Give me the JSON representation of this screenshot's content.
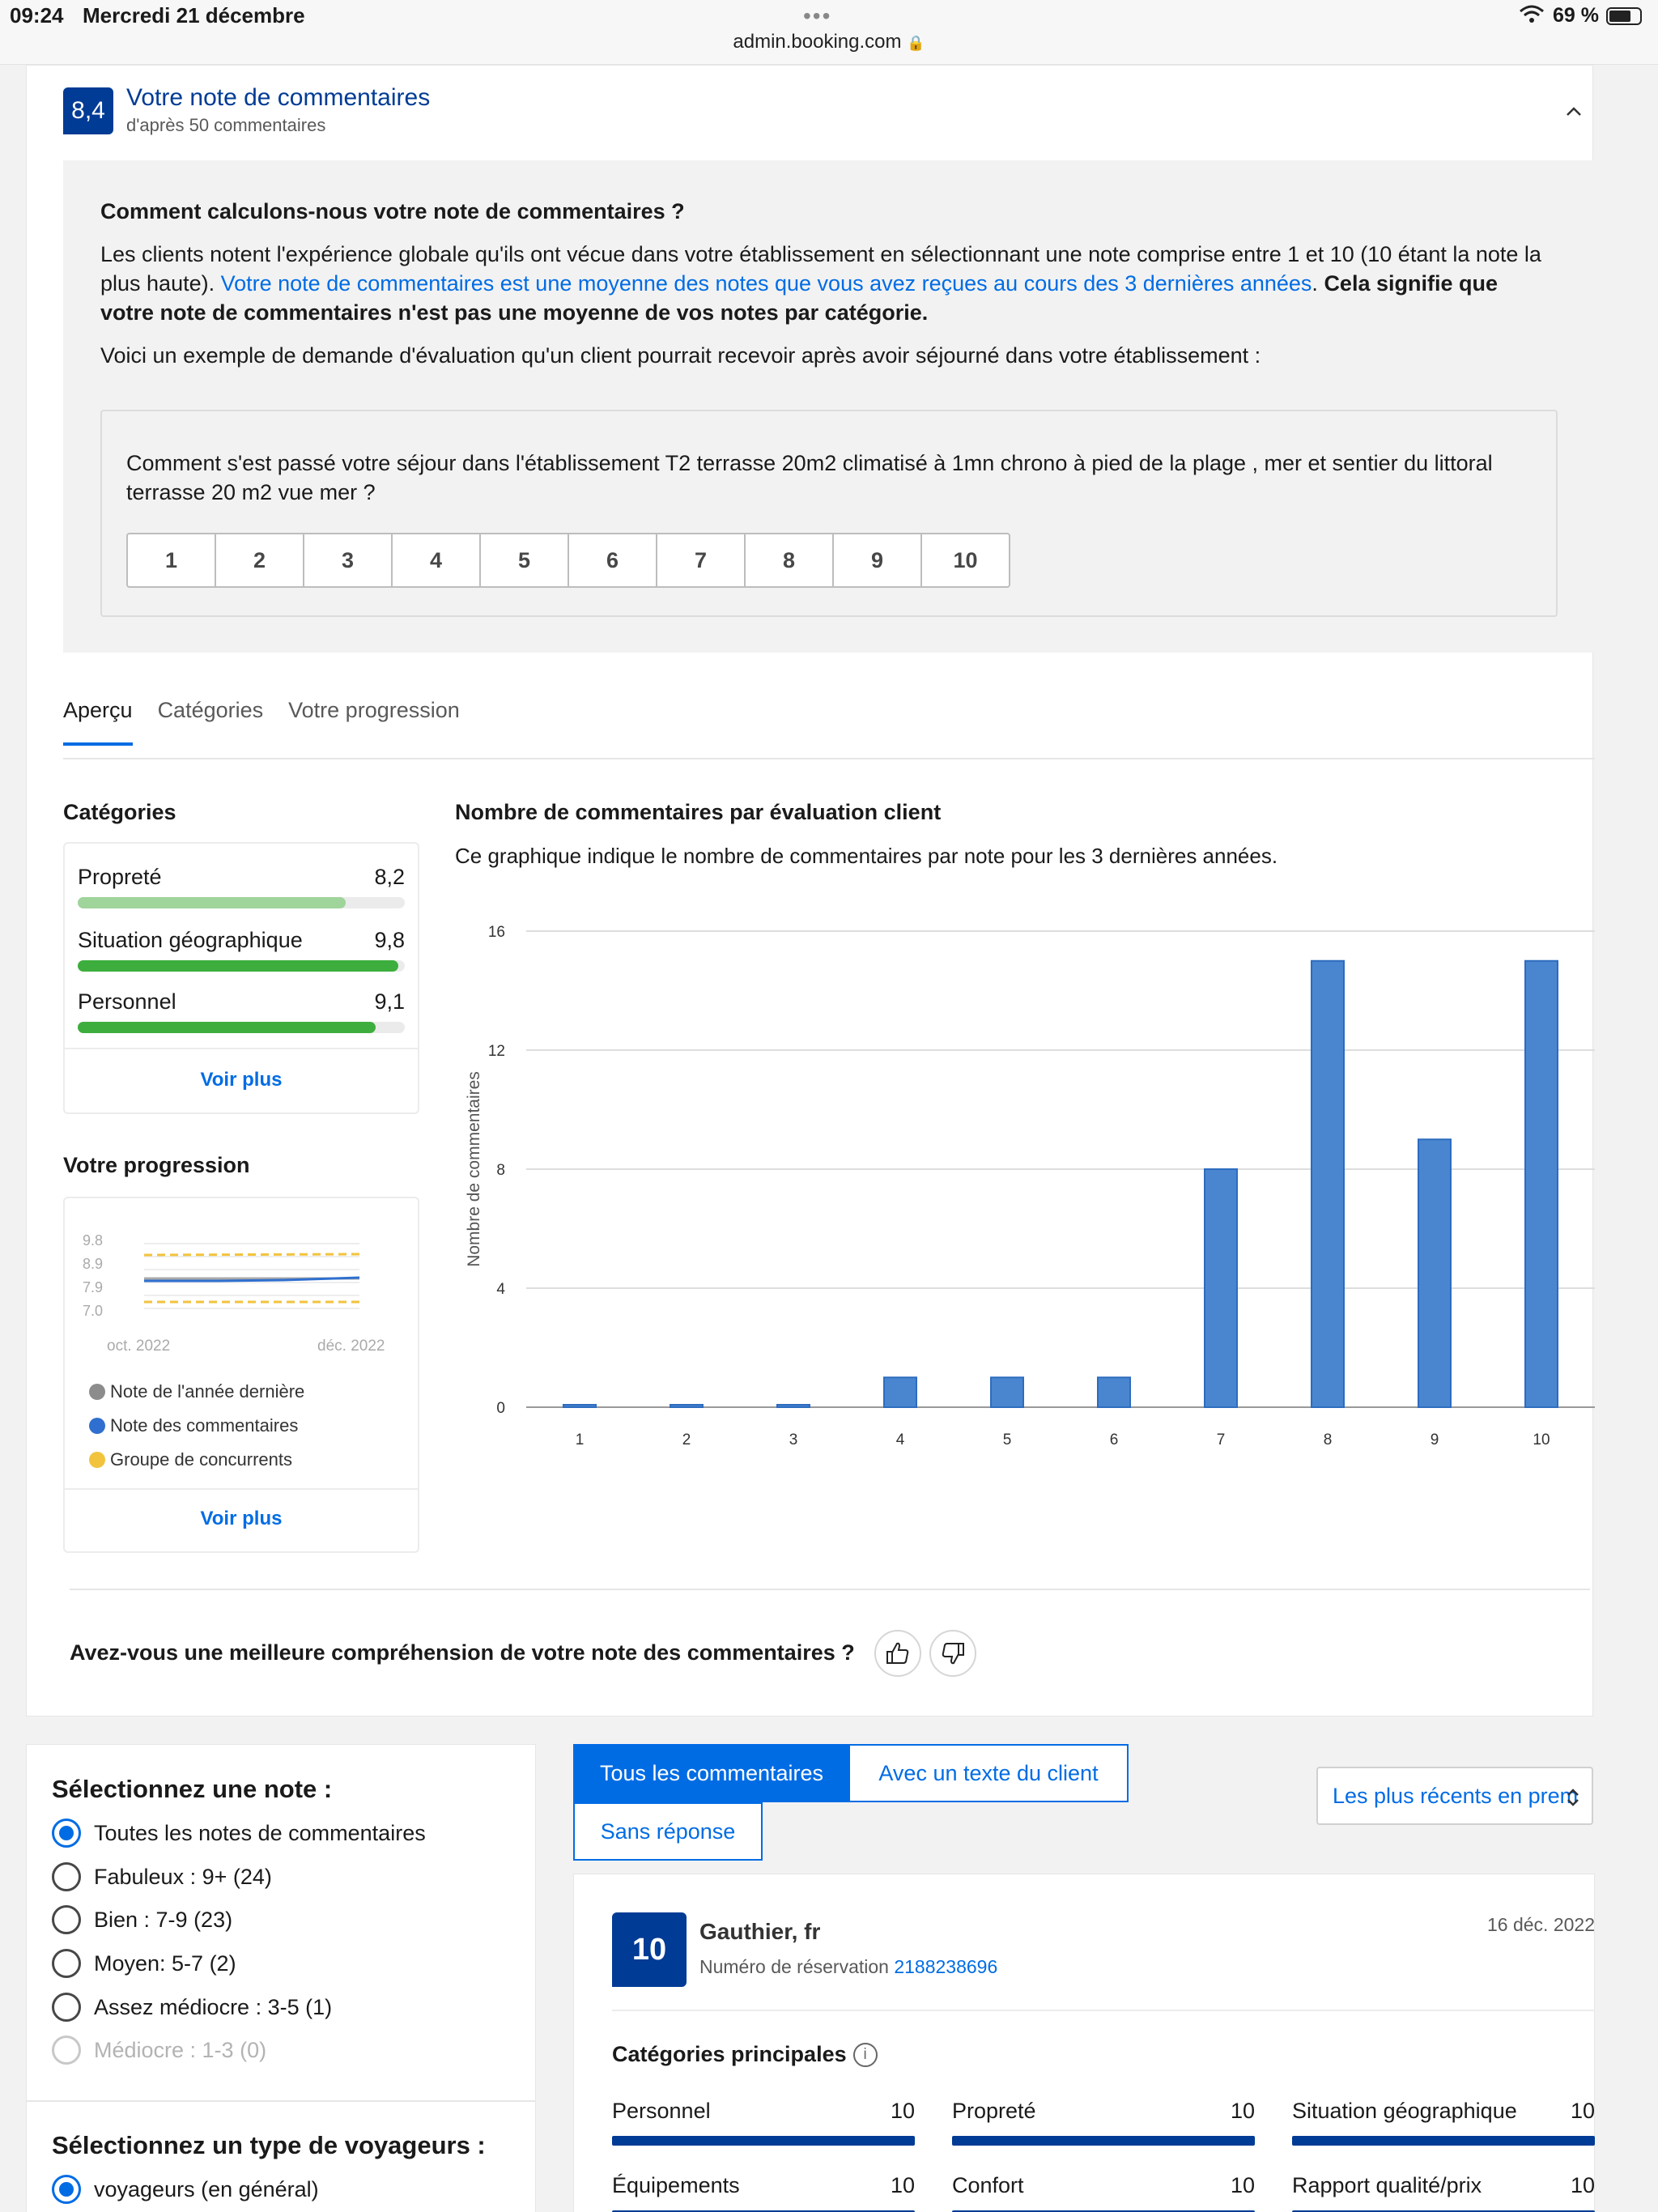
{
  "status": {
    "time": "09:24",
    "date": "Mercredi 21 décembre",
    "url": "admin.booking.com",
    "battery": "69 %"
  },
  "score": {
    "value": "8,4",
    "title": "Votre note de commentaires",
    "subtitle": "d'après 50 commentaires"
  },
  "info": {
    "heading": "Comment calculons-nous votre note de commentaires ?",
    "para_a": "Les clients notent l'expérience globale qu'ils ont vécue dans votre établissement en sélectionnant une note comprise entre 1 et 10 (10 étant la note la plus haute). ",
    "para_link": "Votre note de commentaires est une moyenne des notes que vous avez reçues au cours des 3 dernières années",
    "para_b": ". ",
    "para_bold": "Cela signifie que votre note de commentaires n'est pas une moyenne de vos notes par catégorie.",
    "example_intro": "Voici un exemple de demande d'évaluation qu'un client pourrait recevoir après avoir séjourné dans votre établissement :",
    "example_question": "Comment s'est passé votre séjour dans l'établissement T2 terrasse 20m2 climatisé à 1mn chrono à pied de la plage , mer et sentier du littoral terrasse 20 m2 vue mer ?",
    "rating_options": [
      "1",
      "2",
      "3",
      "4",
      "5",
      "6",
      "7",
      "8",
      "9",
      "10"
    ]
  },
  "tabs": [
    {
      "label": "Aperçu",
      "active": true
    },
    {
      "label": "Catégories",
      "active": false
    },
    {
      "label": "Votre progression",
      "active": false
    }
  ],
  "categories": {
    "heading": "Catégories",
    "items": [
      {
        "name": "Propreté",
        "value": "8,2",
        "score": 8.2,
        "color": "#9fd49b"
      },
      {
        "name": "Situation géographique",
        "value": "9,8",
        "score": 9.8,
        "color": "#3dae3d"
      },
      {
        "name": "Personnel",
        "value": "9,1",
        "score": 9.1,
        "color": "#3dae3d"
      }
    ],
    "more": "Voir plus"
  },
  "progression": {
    "heading": "Votre progression",
    "y_ticks": [
      "9.8",
      "8.9",
      "7.9",
      "7.0"
    ],
    "x_ticks": [
      "oct. 2022",
      "déc. 2022"
    ],
    "legend": [
      {
        "label": "Note de l'année dernière",
        "color": "#8c8c8c"
      },
      {
        "label": "Note des commentaires",
        "color": "#2f6fcf"
      },
      {
        "label": "Groupe de concurrents",
        "color": "#f2c33d"
      }
    ],
    "more": "Voir plus"
  },
  "chart_data": {
    "type": "bar",
    "title": "Nombre de commentaires par évaluation client",
    "subtitle": "Ce graphique indique le nombre de commentaires par note pour les 3 dernières années.",
    "xlabel": "",
    "ylabel": "Nombre de commentaires",
    "categories": [
      "1",
      "2",
      "3",
      "4",
      "5",
      "6",
      "7",
      "8",
      "9",
      "10"
    ],
    "values": [
      0,
      0,
      0,
      1,
      1,
      1,
      8,
      15,
      9,
      15
    ],
    "ylim": [
      0,
      16
    ],
    "y_ticks": [
      0,
      4,
      8,
      12,
      16
    ],
    "grid": true,
    "bar_color": "#4a86cf"
  },
  "feedback": {
    "question": "Avez-vous une meilleure compréhension de votre note des commentaires ?"
  },
  "filters": {
    "note_heading": "Sélectionnez une note :",
    "note_options": [
      {
        "label": "Toutes les notes de commentaires",
        "checked": true,
        "disabled": false
      },
      {
        "label": "Fabuleux : 9+ (24)",
        "checked": false,
        "disabled": false
      },
      {
        "label": "Bien : 7-9 (23)",
        "checked": false,
        "disabled": false
      },
      {
        "label": "Moyen: 5-7 (2)",
        "checked": false,
        "disabled": false
      },
      {
        "label": "Assez médiocre : 3-5 (1)",
        "checked": false,
        "disabled": false
      },
      {
        "label": "Médiocre : 1-3 (0)",
        "checked": false,
        "disabled": true
      }
    ],
    "traveler_heading": "Sélectionnez un type de voyageurs :",
    "traveler_options": [
      {
        "label": "voyageurs (en général)",
        "checked": true
      }
    ]
  },
  "review_list": {
    "seg_all": "Tous les commentaires",
    "seg_text": "Avec un texte du client",
    "seg_noresp": "Sans réponse",
    "sort_value": "Les plus récents en prem"
  },
  "review": {
    "score": "10",
    "reviewer": "Gauthier, fr",
    "resa_label": "Numéro de réservation",
    "resa_number": "2188238696",
    "date": "16 déc. 2022",
    "main_categories_label": "Catégories principales",
    "categories": [
      {
        "name": "Personnel",
        "value": "10"
      },
      {
        "name": "Propreté",
        "value": "10"
      },
      {
        "name": "Situation géographique",
        "value": "10"
      },
      {
        "name": "Équipements",
        "value": "10"
      },
      {
        "name": "Confort",
        "value": "10"
      },
      {
        "name": "Rapport qualité/prix",
        "value": "10"
      }
    ]
  }
}
